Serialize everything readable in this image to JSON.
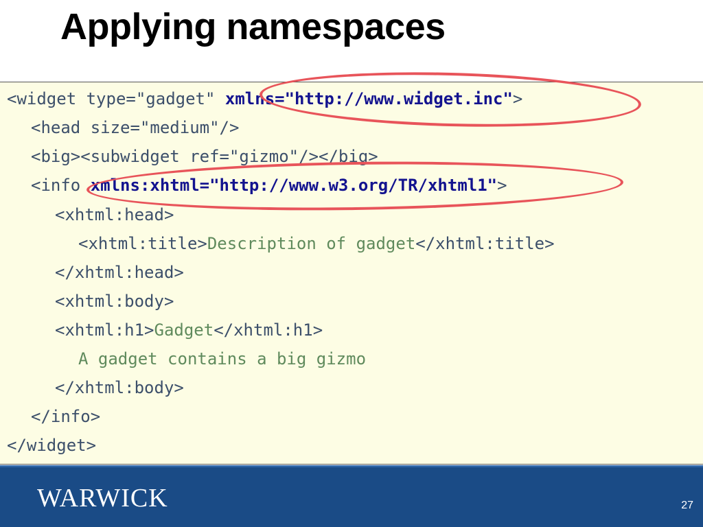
{
  "slide": {
    "title": "Applying namespaces",
    "page_number": "27"
  },
  "code": {
    "l1_pre": "<widget type=\"gadget\" ",
    "l1_ns": "xmlns=\"http://www.widget.inc\"",
    "l1_post": ">",
    "l2": "<head size=\"medium\"/>",
    "l3": "<big><subwidget ref=\"gizmo\"/></big>",
    "l4_pre": "<info ",
    "l4_ns": "xmlns:xhtml=\"http://www.w3.org/TR/xhtml1\"",
    "l4_post": ">",
    "l5": "<xhtml:head>",
    "l6_open": "<xhtml:title>",
    "l6_text": "Description of gadget",
    "l6_close": "</xhtml:title>",
    "l7": "</xhtml:head>",
    "l8": "<xhtml:body>",
    "l9_open": "<xhtml:h1>",
    "l9_text": "Gadget",
    "l9_close": "</xhtml:h1>",
    "l10_text": "A gadget contains a big gizmo",
    "l11": "</xhtml:body>",
    "l12": "</info>",
    "l13": "</widget>"
  },
  "footer": {
    "logo_text": "WARWICK"
  },
  "colors": {
    "highlight": "#e8545a",
    "code_background": "#fdfde4",
    "footer_background": "#1a4b86"
  }
}
